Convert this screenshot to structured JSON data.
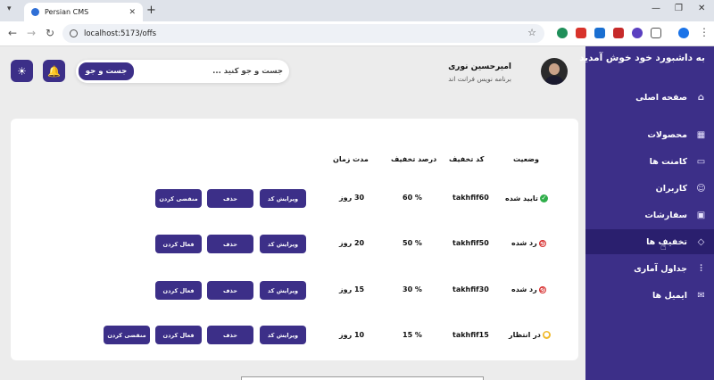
{
  "browser": {
    "tab_title": "Persian CMS",
    "tab_close": "✕",
    "new_tab": "+",
    "url": "localhost:5173/offs",
    "window_controls": [
      "—",
      "❐",
      "✕"
    ]
  },
  "sidebar": {
    "title": "به داشبورد خود خوش آمدید",
    "items": [
      {
        "label": "صفحه اصلی",
        "icon": "home-icon"
      },
      {
        "label": "محصولات",
        "icon": "grid-icon"
      },
      {
        "label": "کامنت ها",
        "icon": "comment-icon"
      },
      {
        "label": "کاربران",
        "icon": "users-icon"
      },
      {
        "label": "سفارشات",
        "icon": "clipboard-icon"
      },
      {
        "label": "تخفیف ها",
        "icon": "tag-icon"
      },
      {
        "label": "جداول آماری",
        "icon": "bar-chart-icon"
      },
      {
        "label": "ایمیل ها",
        "icon": "mail-icon"
      }
    ],
    "active_index": 5,
    "colors": {
      "background": "#3c2f88",
      "active": "#2a1f6e"
    }
  },
  "header": {
    "search_placeholder": "جست و جو کنید ...",
    "search_button": "جست و جو",
    "user_name": "امیرحسین نوری",
    "user_role": "برنامه نویس فرانت اند"
  },
  "table": {
    "headers": [
      "وضعیت",
      "کد تخفیف",
      "درصد تخفیف",
      "مدت زمان"
    ],
    "rows": [
      {
        "status": "تایید شده",
        "status_type": "ok",
        "code": "takhfif60",
        "percent": "60 %",
        "duration": "30 روز",
        "actions": [
          "ویرایش کد",
          "حذف",
          "منقضی کردن"
        ]
      },
      {
        "status": "رد شده",
        "status_type": "no",
        "code": "takhfif50",
        "percent": "50 %",
        "duration": "20 روز",
        "actions": [
          "ویرایش کد",
          "حذف",
          "فعال کردن"
        ]
      },
      {
        "status": "رد شده",
        "status_type": "no",
        "code": "takhfif30",
        "percent": "30 %",
        "duration": "15 روز",
        "actions": [
          "ویرایش کد",
          "حذف",
          "فعال کردن"
        ]
      },
      {
        "status": "در انتظار",
        "status_type": "wait",
        "code": "takhfif15",
        "percent": "15 %",
        "duration": "10 روز",
        "actions": [
          "ویرایش کد",
          "حذف",
          "فعال کردن",
          "منقضی کردن"
        ]
      }
    ]
  },
  "colors": {
    "accent": "#3c2f88",
    "ok": "#2fae4a",
    "rejected": "#d62828",
    "pending": "#f0b92a"
  }
}
